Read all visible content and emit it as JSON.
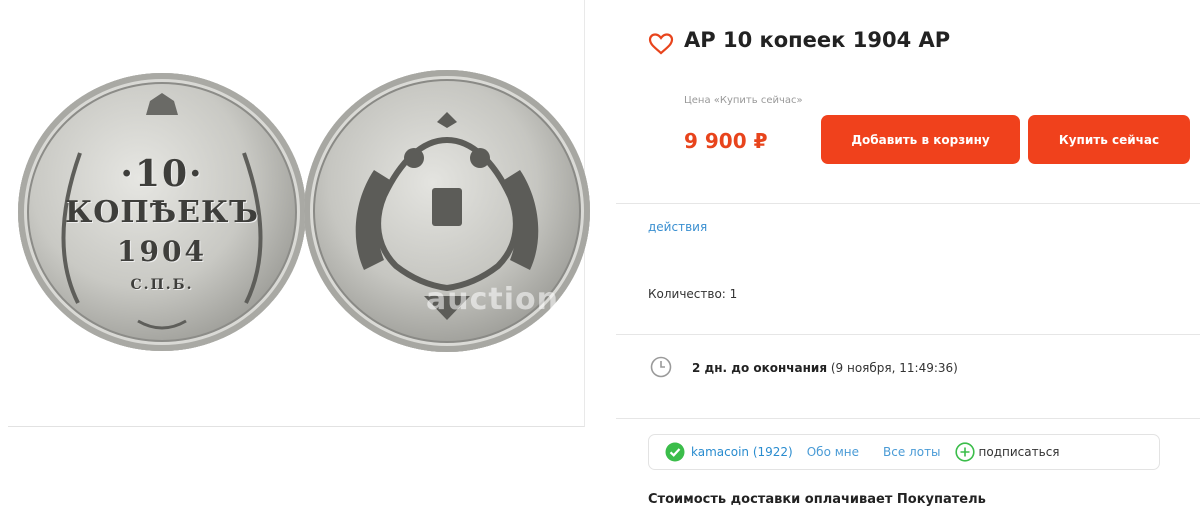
{
  "gallery": {
    "obverse": {
      "denomination": "·10·",
      "word": "КОПѢЕКЪ",
      "year": "1904",
      "mint": "С.П.Б."
    },
    "watermark": "auction"
  },
  "lot": {
    "title": "АР 10 копеек 1904 АР",
    "price_label": "Цена «Купить сейчас»",
    "price": "9 900 ₽",
    "add_to_cart": "Добавить в корзину",
    "buy_now": "Купить сейчас",
    "actions_link": "действия",
    "quantity": "Количество: 1",
    "time_remaining": "2 дн. до окончания",
    "end_date": "(9 ноября, 11:49:36)"
  },
  "seller": {
    "name": "kamacoin (1922)",
    "about": "Обо мне",
    "all_lots": "Все лоты",
    "subscribe": "подписаться"
  },
  "delivery_note": "Стоимость доставки оплачивает Покупатель",
  "colors": {
    "accent": "#f0411c",
    "price": "#e8441c",
    "link": "#3a8fd0",
    "check": "#3bbd4a"
  },
  "icons": {
    "favorite": "heart-icon",
    "timer": "clock-icon",
    "verified": "check-circle-icon",
    "subscribe": "plus-circle-icon"
  }
}
